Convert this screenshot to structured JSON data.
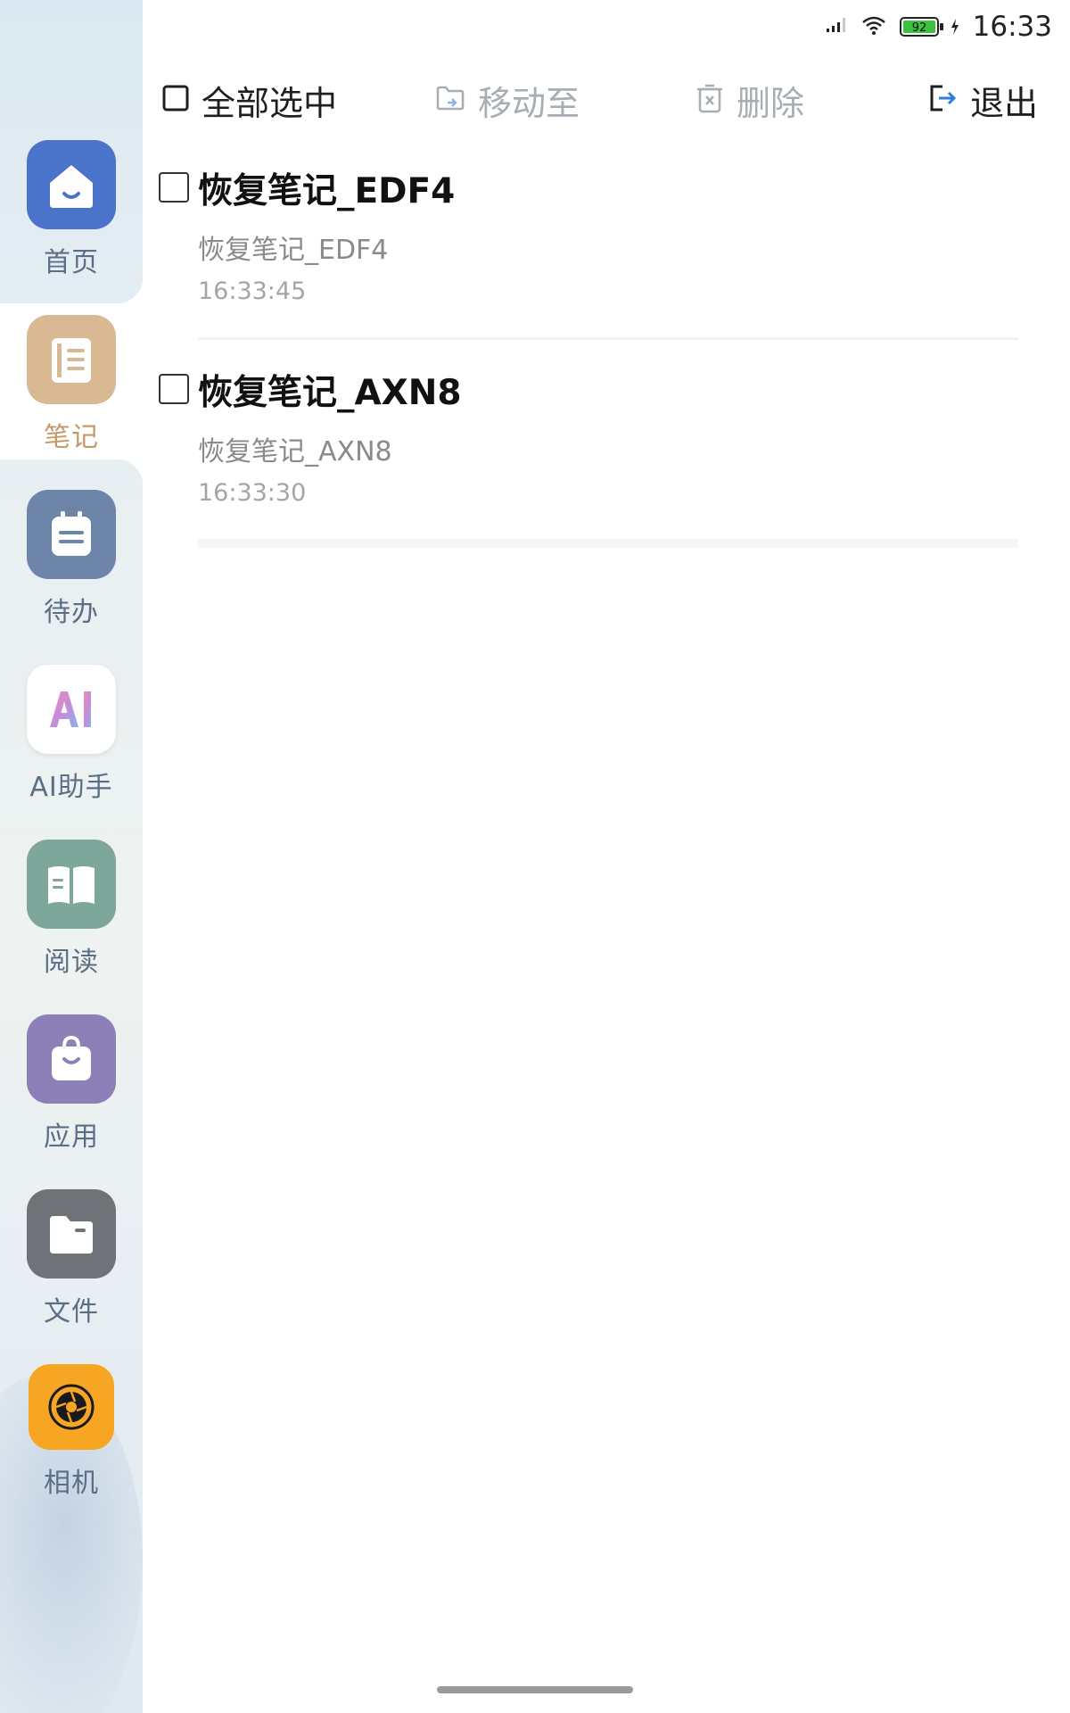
{
  "status_bar": {
    "time": "16:33",
    "battery_level": "92",
    "icons": [
      "signal-icon",
      "wifi-icon",
      "battery-icon",
      "charging-icon"
    ]
  },
  "sidebar": {
    "items": [
      {
        "label": "首页",
        "icon": "home-icon",
        "color": "#4a73c9",
        "active": false
      },
      {
        "label": "笔记",
        "icon": "notebook-icon",
        "color": "#d4b08c",
        "active": true
      },
      {
        "label": "待办",
        "icon": "calendar-todo-icon",
        "color": "#6d85a8",
        "active": false
      },
      {
        "label": "AI助手",
        "icon": "ai-assistant-icon",
        "color": "#ffffff",
        "active": false
      },
      {
        "label": "阅读",
        "icon": "book-icon",
        "color": "#7ea79b",
        "active": false
      },
      {
        "label": "应用",
        "icon": "shopping-bag-icon",
        "color": "#8d7fb8",
        "active": false
      },
      {
        "label": "文件",
        "icon": "folder-icon",
        "color": "#6f7378",
        "active": false
      },
      {
        "label": "相机",
        "icon": "camera-aperture-icon",
        "color": "#f6a623",
        "active": false
      }
    ]
  },
  "toolbar": {
    "select_all": "全部选中",
    "move_to": "移动至",
    "delete": "删除",
    "exit": "退出"
  },
  "notes": [
    {
      "title": "恢复笔记_EDF4",
      "preview": "恢复笔记_EDF4",
      "time": "16:33:45"
    },
    {
      "title": "恢复笔记_AXN8",
      "preview": "恢复笔记_AXN8",
      "time": "16:33:30"
    }
  ],
  "colors": {
    "accent_blue": "#2f7be0",
    "active_label": "#c49a6a",
    "disabled_text": "#a7adb4"
  }
}
